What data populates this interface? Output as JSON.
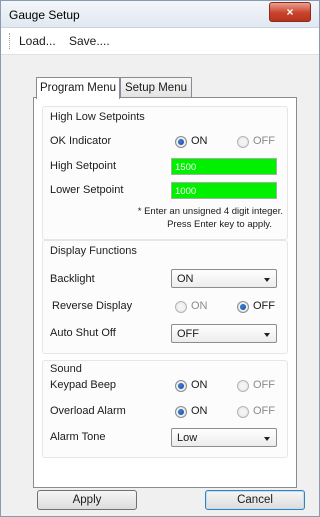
{
  "window": {
    "title": "Gauge Setup",
    "close_glyph": "×"
  },
  "menu": {
    "items": [
      "Load...",
      "Save...."
    ]
  },
  "tabs": [
    {
      "label": "Program Menu",
      "active": true
    },
    {
      "label": "Setup Menu",
      "active": false
    }
  ],
  "high_low": {
    "title": "High Low Setpoints",
    "ok_indicator": {
      "label": "OK Indicator",
      "on": "ON",
      "off": "OFF",
      "selected": "ON"
    },
    "high_setpoint": {
      "label": "High Setpoint",
      "value": "1500"
    },
    "lower_setpoint": {
      "label": "Lower Setpoint",
      "value": "1000"
    },
    "note_line1": "* Enter an unsigned 4 digit integer.",
    "note_line2": "Press Enter key to apply."
  },
  "display": {
    "title": "Display Functions",
    "backlight": {
      "label": "Backlight",
      "value": "ON"
    },
    "reverse": {
      "label": "Reverse Display",
      "on": "ON",
      "off": "OFF",
      "selected": "OFF"
    },
    "auto_shut_off": {
      "label": "Auto Shut Off",
      "value": "OFF"
    }
  },
  "sound": {
    "title": "Sound",
    "keypad_beep": {
      "label": "Keypad Beep",
      "on": "ON",
      "off": "OFF",
      "selected": "ON"
    },
    "overload_alarm": {
      "label": "Overload Alarm",
      "on": "ON",
      "off": "OFF",
      "selected": "ON"
    },
    "alarm_tone": {
      "label": "Alarm Tone",
      "value": "Low"
    }
  },
  "buttons": {
    "apply": "Apply",
    "cancel": "Cancel"
  },
  "colors": {
    "setpoint_field": "#00f000",
    "close_button": "#c7432b",
    "radio_selected": "#1f5fc0"
  }
}
